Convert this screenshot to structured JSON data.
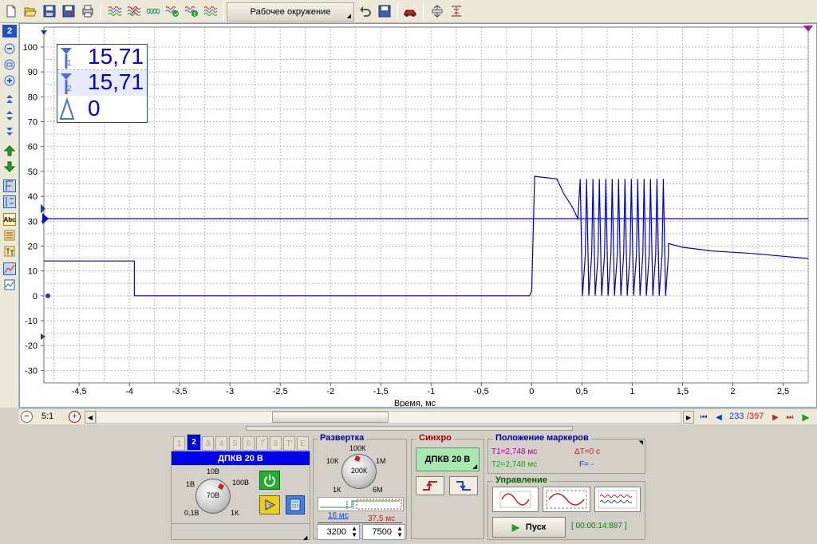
{
  "toolbar": {
    "workspace_label": "Рабочее окружение"
  },
  "sidebar": {
    "channel_badge": "2",
    "text_tool_label": "Abc"
  },
  "markers_box": {
    "t1_value": "15,71",
    "t2_value": "15,71",
    "delta_value": "0",
    "t1_sub": "1",
    "t2_sub": "2"
  },
  "chart_data": {
    "type": "line",
    "xlabel": "Время, мс",
    "ylabel": "",
    "xlim": [
      -4.85,
      2.75
    ],
    "ylim": [
      -35,
      108
    ],
    "x_ticks": [
      -4.5,
      -4,
      -3.5,
      -3,
      -2.5,
      -2,
      -1.5,
      -1,
      -0.5,
      0,
      0.5,
      1,
      1.5,
      2,
      2.5
    ],
    "x_tick_labels": [
      "-4,5",
      "-4",
      "-3,5",
      "-3",
      "-2,5",
      "-2",
      "-1,5",
      "-1",
      "-0,5",
      "0",
      "0,5",
      "1",
      "1,5",
      "2",
      "2,5"
    ],
    "y_ticks": [
      100,
      90,
      80,
      70,
      60,
      50,
      40,
      30,
      20,
      10,
      0,
      -10,
      -20,
      -30
    ],
    "y_tick_labels": [
      "100",
      "90",
      "80",
      "70",
      "60",
      "50",
      "40",
      "30",
      "20",
      "10",
      "0",
      "-10",
      "-20",
      "-30"
    ],
    "grid": true,
    "trigger_level": 31,
    "colors": {
      "trace": "#0000cc",
      "grid": "#b8b8b8",
      "accent": "#0000ff"
    },
    "series": [
      {
        "x": [
          -4.85,
          -3.95,
          -3.95,
          -0.02,
          0.0,
          0.03,
          0.25,
          0.32,
          0.4,
          0.46
        ],
        "values": [
          14,
          14,
          0,
          0,
          2,
          48,
          47,
          41,
          36,
          31
        ]
      }
    ],
    "burst": {
      "x_start": 0.47,
      "x_end": 1.36,
      "count": 14,
      "high": 47,
      "low": 0
    },
    "decay": {
      "x": [
        1.36,
        1.5,
        1.8,
        2.2,
        2.75
      ],
      "values": [
        21,
        19.5,
        18,
        17,
        15
      ]
    }
  },
  "scroll": {
    "zoom_label": "5:1",
    "frame_current": "233",
    "frame_total": "/397"
  },
  "channels": {
    "tabs": [
      "1",
      "2",
      "3",
      "4",
      "5",
      "6",
      "7̅",
      "8",
      "T'",
      "E"
    ],
    "active_tab": "2",
    "title": "ДПКВ 20 В",
    "dial_labels": [
      "10В",
      "1В",
      "100В",
      "0,1В",
      "1К"
    ],
    "dial_center": "70В"
  },
  "sweep": {
    "title": "Развертка",
    "dial_labels": [
      "100К",
      "10К",
      "1М",
      "1К",
      "6М"
    ],
    "dial_center": "200К",
    "time_a": "16 мс",
    "time_b": "37,5 мс",
    "spin_a": "3200",
    "spin_b": "7500"
  },
  "sync": {
    "title": "Синхро",
    "source_label": "ДПКВ 20 В"
  },
  "marker_pos": {
    "title": "Положение маркеров",
    "t1": "T1=2,748 мс",
    "t2": "T2=2,748 мс",
    "dt": "ΔT=0 с",
    "f": "F= -"
  },
  "control": {
    "title": "Управление",
    "start_label": "Пуск",
    "timer": "[ 00:00:14:887 ]"
  }
}
